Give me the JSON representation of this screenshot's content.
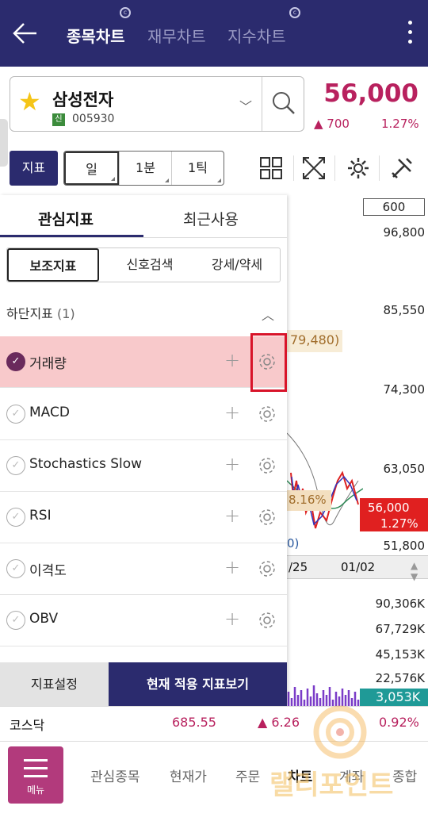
{
  "header": {
    "tab_stock_chart": "종목차트",
    "tab_financial_chart": "재무차트",
    "tab_index_chart": "지수차트"
  },
  "stock": {
    "name": "삼성전자",
    "badge": "신",
    "code": "005930",
    "price": "56,000",
    "change": "▲ 700",
    "change_pct": "1.27%"
  },
  "toolbar": {
    "indicator_label": "지표",
    "periods": [
      "일",
      "1분",
      "1틱"
    ]
  },
  "chart": {
    "count_box": "600",
    "y_labels": [
      "96,800",
      "85,550",
      "74,300",
      "63,050",
      "51,800"
    ],
    "current_price": "56,000",
    "current_pct": "1.27%",
    "annotation_high": "79,480)",
    "annotation_pct": "8.16%",
    "annotation_low": "0)",
    "date_labels": [
      "/25",
      "01/02"
    ],
    "volume_labels": [
      "90,306K",
      "67,729K",
      "45,153K",
      "22,576K"
    ],
    "volume_current": "3,053K"
  },
  "panel": {
    "tabs": [
      "관심지표",
      "최근사용"
    ],
    "subtabs": [
      "보조지표",
      "신호검색",
      "강세/약세"
    ],
    "group_label": "하단지표",
    "group_count": "(1)",
    "rows": [
      {
        "label": "거래량",
        "checked": true
      },
      {
        "label": "MACD",
        "checked": false
      },
      {
        "label": "Stochastics Slow",
        "checked": false
      },
      {
        "label": "RSI",
        "checked": false
      },
      {
        "label": "이격도",
        "checked": false
      },
      {
        "label": "OBV",
        "checked": false
      }
    ],
    "footer_settings": "지표설정",
    "footer_view": "현재 적용 지표보기"
  },
  "index_bar": {
    "name": "코스닥",
    "value": "685.55",
    "change": "▲ 6.26",
    "pct": "0.92%"
  },
  "bottom_nav": {
    "menu_label": "메뉴",
    "items": [
      "관심종목",
      "현재가",
      "주문",
      "차트",
      "계좌",
      "종합"
    ]
  },
  "watermark": {
    "text": "랠리포인트"
  },
  "colors": {
    "navy": "#2b2b6e",
    "up_red": "#b8215e",
    "highlight": "#f8c9cb",
    "check_purple": "#6a2a5c",
    "menu_magenta": "#b23a7c"
  }
}
